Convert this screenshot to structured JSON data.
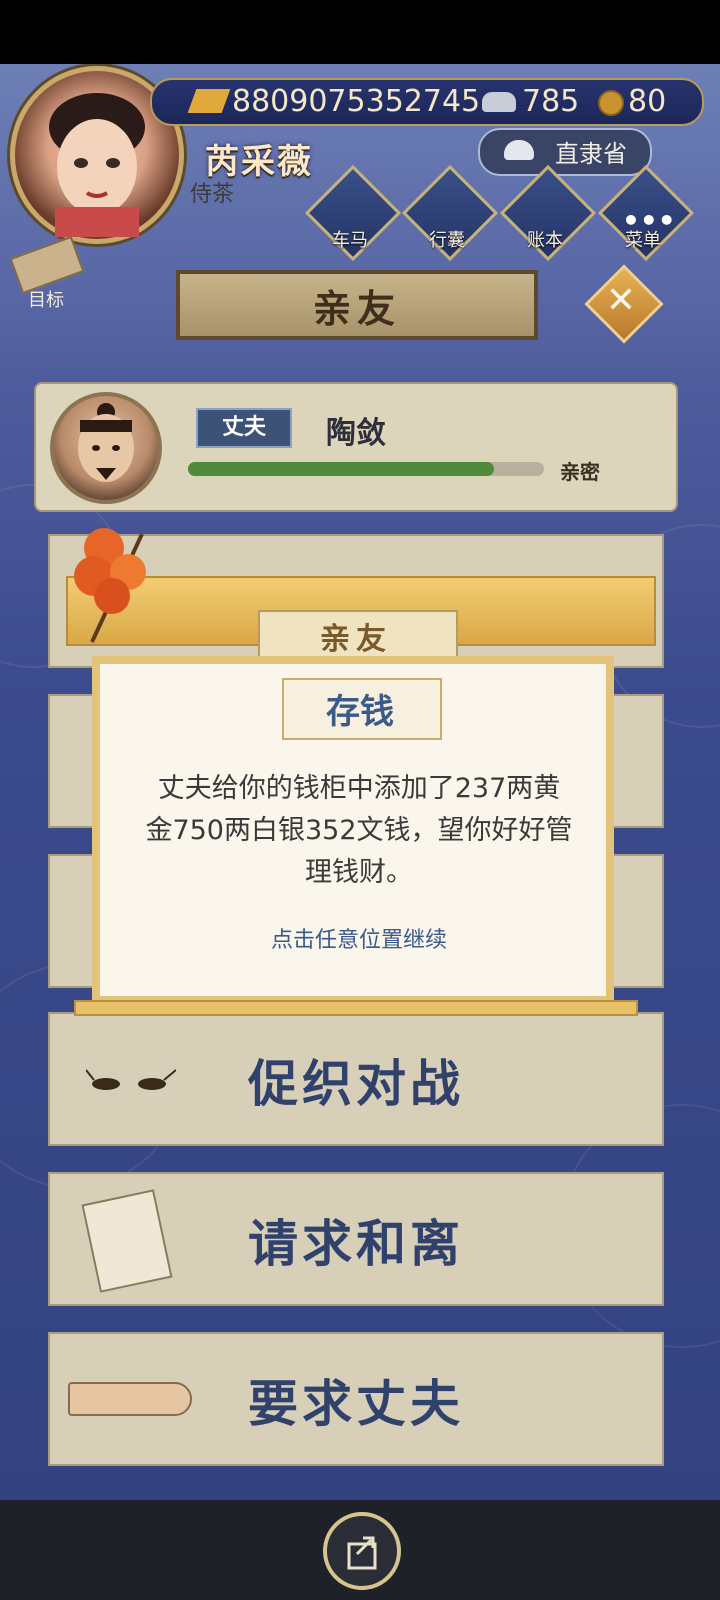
{
  "resources": {
    "gold": "8809075352745",
    "silver": "785",
    "coins": "80"
  },
  "player": {
    "name": "芮采薇",
    "rank": "侍茶"
  },
  "region": {
    "label": "直隶省"
  },
  "menu": [
    {
      "label": "车马"
    },
    {
      "label": "行囊"
    },
    {
      "label": "账本"
    },
    {
      "label": "菜单"
    }
  ],
  "goal": {
    "label": "目标"
  },
  "page": {
    "title": "亲友"
  },
  "husband": {
    "tag": "丈夫",
    "name": "陶敛",
    "bond_label": "亲密",
    "bond_level": 0.86
  },
  "panels": [
    {
      "label": "促织对战"
    },
    {
      "label": "请求和离"
    },
    {
      "label": "要求丈夫"
    }
  ],
  "modal": {
    "banner_title": "亲友",
    "message_title": "存钱",
    "message_line1": "丈夫给你的钱柜中添加了237两黄",
    "message_line2": "金750两白银352文钱，望你好好管",
    "message_line3": "理钱财。",
    "continue_hint": "点击任意位置继续"
  },
  "colors": {
    "accent": "#30416b",
    "gold": "#e3c37a",
    "bond": "#4f8a3a"
  }
}
